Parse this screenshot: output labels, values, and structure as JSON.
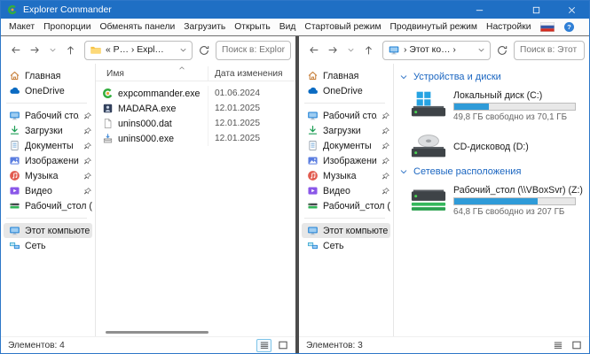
{
  "window": {
    "title": "Explorer Commander"
  },
  "menu": {
    "items": [
      "Макет",
      "Пропорции",
      "Обменять панели",
      "Загрузить",
      "Открыть",
      "Вид",
      "Стартовый режим",
      "Продвинутый режим",
      "Настройки"
    ]
  },
  "colors": {
    "accent": "#1f6fc4",
    "drive_bar_fill": "#2f9bd8",
    "section_header": "#1b66c1"
  },
  "sidebar": {
    "top": [
      {
        "label": "Главная"
      },
      {
        "label": "OneDrive"
      }
    ],
    "pinned": [
      {
        "label": "Рабочий стол"
      },
      {
        "label": "Загрузки"
      },
      {
        "label": "Документы"
      },
      {
        "label": "Изображения"
      },
      {
        "label": "Музыка"
      },
      {
        "label": "Видео"
      },
      {
        "label": "Рабочий_стол (\\\\VB"
      }
    ],
    "bottom": [
      {
        "label": "Этот компьютер",
        "selected": true
      },
      {
        "label": "Сеть"
      }
    ]
  },
  "left_panel": {
    "breadcrumb": "« P… › Expl…",
    "search_placeholder": "Поиск в: Explorer C",
    "list": {
      "name_column": "Имя",
      "date_column": "Дата изменения",
      "rows": [
        {
          "name": "expcommander.exe",
          "date": "01.06.2024"
        },
        {
          "name": "MADARA.exe",
          "date": "12.01.2025"
        },
        {
          "name": "unins000.dat",
          "date": "12.01.2025"
        },
        {
          "name": "unins000.exe",
          "date": "12.01.2025"
        }
      ]
    },
    "status": "Элементов: 4"
  },
  "right_panel": {
    "breadcrumb": "› Этот ко… ›",
    "search_placeholder": "Поиск в: Этот комп",
    "sections": [
      {
        "title": "Устройства и диски"
      },
      {
        "title": "Сетевые расположения"
      }
    ],
    "drives": {
      "c": {
        "name": "Локальный диск (C:)",
        "free": "49,8 ГБ свободно из 70,1 ГБ",
        "used_pct": 29
      },
      "d": {
        "name": "CD-дисковод (D:)"
      },
      "z": {
        "name": "Рабочий_стол (\\\\VBoxSvr) (Z:)",
        "free": "64,8 ГБ свободно из 207 ГБ",
        "used_pct": 69
      }
    },
    "status": "Элементов: 3"
  }
}
